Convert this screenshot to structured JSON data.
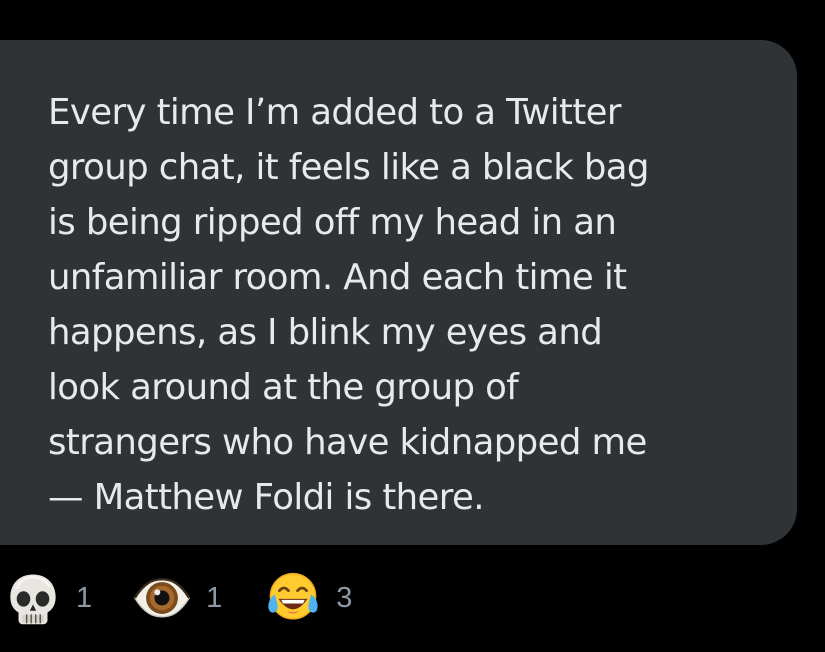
{
  "message": {
    "lines": [
      "Every time I’m added to a Twitter",
      "group chat, it feels like a black bag",
      "is being ripped off my head in an",
      "unfamiliar room. And each time it",
      "happens, as I blink my eyes and",
      "look around at the group of",
      "strangers who have kidnapped me",
      "— Matthew Foldi is there."
    ]
  },
  "reactions": [
    {
      "icon": "skull-emoji",
      "count": "1"
    },
    {
      "icon": "eye-emoji",
      "count": "1"
    },
    {
      "icon": "face-with-tears-of-joy-emoji",
      "count": "3"
    }
  ],
  "colors": {
    "background": "#000000",
    "bubble": "#2f3336",
    "text": "#e7e9ea",
    "count": "#8b98a5"
  }
}
